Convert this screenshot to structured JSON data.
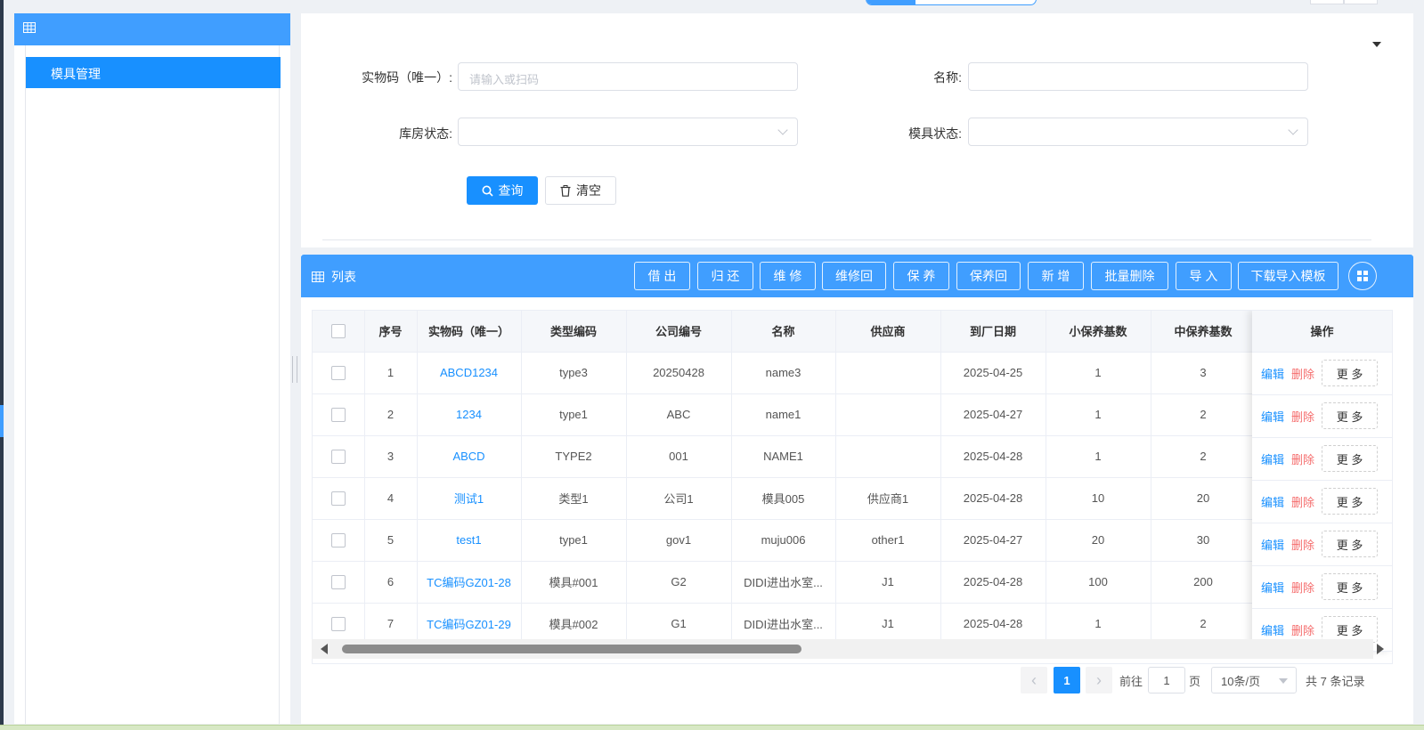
{
  "sidebar": {
    "header_icon": "table-icon",
    "items": [
      {
        "label": "模具管理",
        "selected": true
      }
    ]
  },
  "search": {
    "fields": {
      "code_label": "实物码（唯一）:",
      "code_placeholder": "请输入或扫码",
      "code_value": "",
      "name_label": "名称:",
      "name_value": "",
      "warehouse_status_label": "库房状态:",
      "warehouse_status_value": "",
      "mold_status_label": "模具状态:",
      "mold_status_value": ""
    },
    "query_label": "查询",
    "clear_label": "清空"
  },
  "list": {
    "title": "列表",
    "toolbar": [
      "借 出",
      "归 还",
      "维 修",
      "维修回",
      "保 养",
      "保养回",
      "新 增",
      "批量删除",
      "导 入",
      "下载导入模板"
    ],
    "columns": [
      "序号",
      "实物码（唯一）",
      "类型编码",
      "公司编号",
      "名称",
      "供应商",
      "到厂日期",
      "小保养基数",
      "中保养基数",
      "操作"
    ],
    "rows": [
      {
        "idx": "1",
        "code": "ABCD1234",
        "type": "type3",
        "company": "20250428",
        "name": "name3",
        "supplier": "",
        "date": "2025-04-25",
        "small": "1",
        "mid": "3"
      },
      {
        "idx": "2",
        "code": "1234",
        "type": "type1",
        "company": "ABC",
        "name": "name1",
        "supplier": "",
        "date": "2025-04-27",
        "small": "1",
        "mid": "2"
      },
      {
        "idx": "3",
        "code": "ABCD",
        "type": "TYPE2",
        "company": "001",
        "name": "NAME1",
        "supplier": "",
        "date": "2025-04-28",
        "small": "1",
        "mid": "2"
      },
      {
        "idx": "4",
        "code": "测试1",
        "type": "类型1",
        "company": "公司1",
        "name": "模具005",
        "supplier": "供应商1",
        "date": "2025-04-28",
        "small": "10",
        "mid": "20"
      },
      {
        "idx": "5",
        "code": "test1",
        "type": "type1",
        "company": "gov1",
        "name": "muju006",
        "supplier": "other1",
        "date": "2025-04-27",
        "small": "20",
        "mid": "30"
      },
      {
        "idx": "6",
        "code": "TC编码GZ01-28",
        "type": "模具#001",
        "company": "G2",
        "name": "DIDI进出水室...",
        "supplier": "J1",
        "date": "2025-04-28",
        "small": "100",
        "mid": "200"
      },
      {
        "idx": "7",
        "code": "TC编码GZ01-29",
        "type": "模具#002",
        "company": "G1",
        "name": "DIDI进出水室...",
        "supplier": "J1",
        "date": "2025-04-28",
        "small": "1",
        "mid": "2"
      }
    ],
    "row_actions": {
      "edit": "编辑",
      "delete": "删除",
      "more": "更 多"
    }
  },
  "pagination": {
    "current_page": "1",
    "goto_label": "前往",
    "goto_value": "1",
    "page_suffix": "页",
    "page_size": "10条/页",
    "total_text": "共 7 条记录"
  },
  "colors": {
    "primary": "#1890ff",
    "header_blue": "#409eff",
    "danger": "#f56c6c"
  }
}
